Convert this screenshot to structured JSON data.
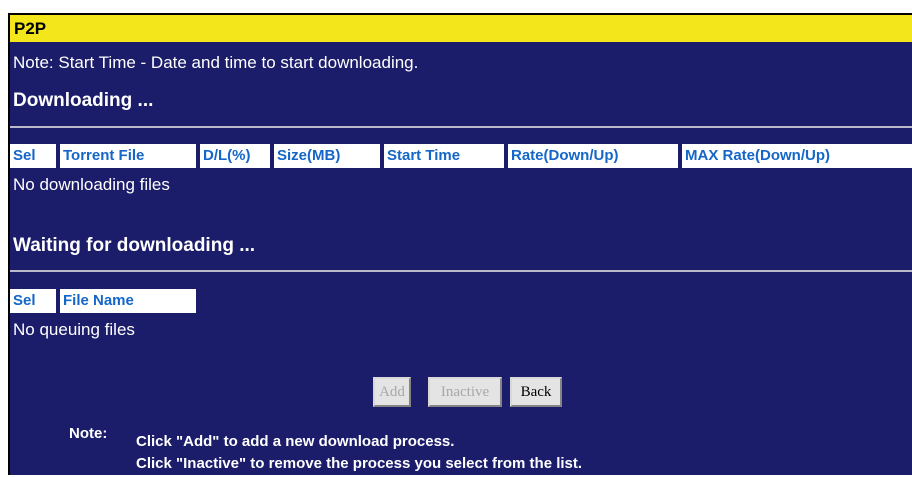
{
  "title": "P2P",
  "note_top": "Note: Start Time - Date and time to start downloading.",
  "downloading": {
    "title": "Downloading ...",
    "headers": [
      "Sel",
      "Torrent File",
      "D/L(%)",
      "Size(MB)",
      "Start Time",
      "Rate(Down/Up)",
      "MAX Rate(Down/Up)"
    ],
    "empty": "No downloading files"
  },
  "waiting": {
    "title": "Waiting for downloading ...",
    "headers": [
      "Sel",
      "File Name"
    ],
    "empty": "No queuing files"
  },
  "buttons": {
    "add": "Add",
    "inactive": "Inactive",
    "back": "Back"
  },
  "footer": {
    "label": "Note:",
    "line1": "Click \"Add\" to add a new download process.",
    "line2": "Click \"Inactive\" to remove the process you select from the list."
  },
  "colors": {
    "panel": "#1b1c6a",
    "titlebar": "#f3e61a",
    "header_text": "#1466c8"
  }
}
